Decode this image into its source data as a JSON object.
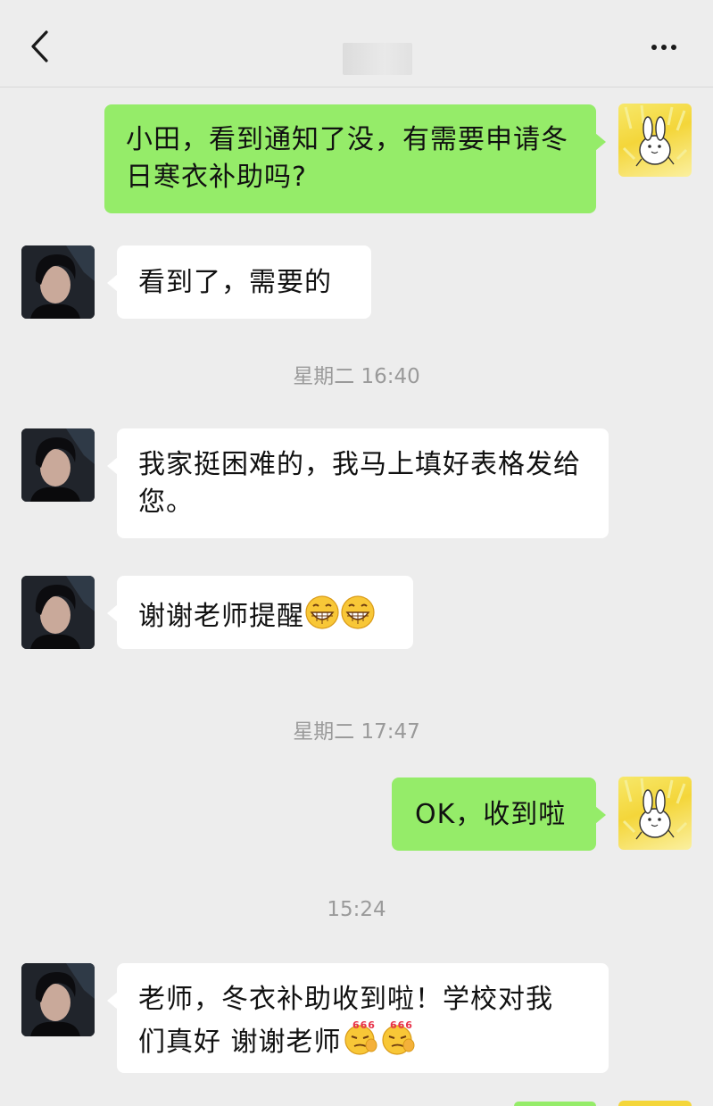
{
  "nav": {
    "back_icon": "chevron-left-icon",
    "more_icon": "more-dots-icon"
  },
  "messages": [
    {
      "sender": "me",
      "text": "小田，看到通知了没，有需要申请冬日寒衣补助吗?"
    },
    {
      "sender": "other",
      "text": "看到了，需要的"
    },
    {
      "type": "time",
      "text": "星期二 16:40"
    },
    {
      "sender": "other",
      "text": "我家挺困难的，我马上填好表格发给您。"
    },
    {
      "sender": "other",
      "text": "谢谢老师提醒",
      "emojis": [
        "grin-emoji",
        "grin-emoji"
      ]
    },
    {
      "type": "time",
      "text": "星期二 17:47"
    },
    {
      "sender": "me",
      "text": "OK，收到啦"
    },
    {
      "type": "time",
      "text": "15:24"
    },
    {
      "sender": "other",
      "text_line1": "老师，冬衣补助收到啦！学校对我",
      "text_line2": "们真好 谢谢老师",
      "emojis": [
        "666-emoji",
        "666-emoji"
      ]
    }
  ],
  "colors": {
    "background": "#ededed",
    "my_bubble": "#95ec69",
    "other_bubble": "#ffffff",
    "timestamp": "#9a9a9a"
  }
}
